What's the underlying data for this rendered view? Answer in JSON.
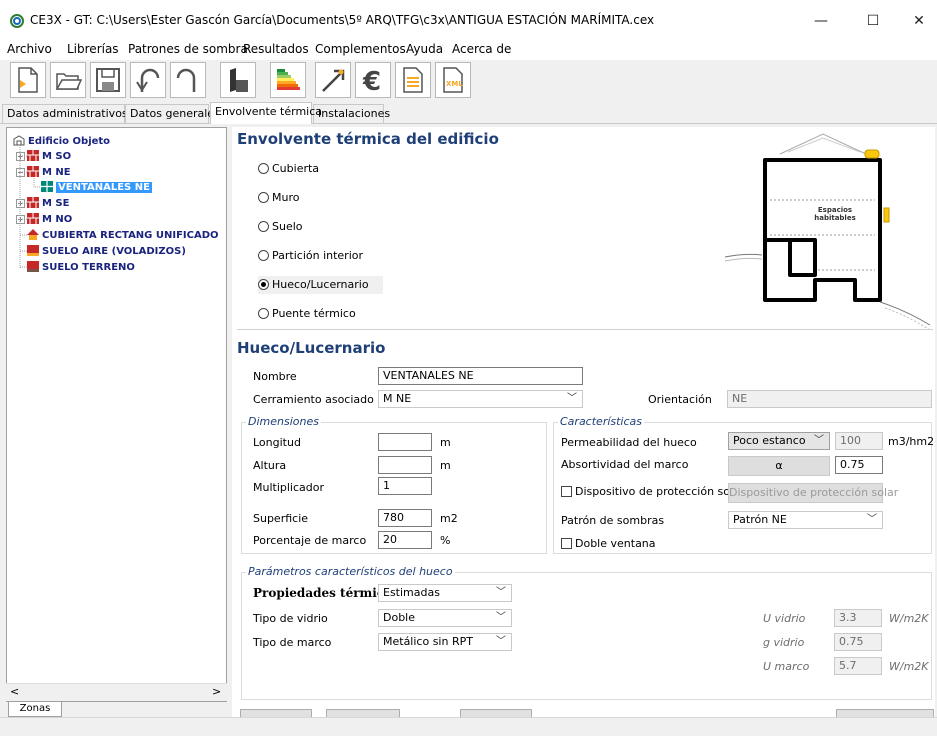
{
  "window": {
    "title": "CE3X - GT: C:\\Users\\Ester Gascón García\\Documents\\5º ARQ\\TFG\\c3x\\ANTIGUA ESTACIÓN MARÍMITA.cex",
    "minimize": "—",
    "maximize": "☐",
    "close": "✕"
  },
  "menu": [
    "Archivo",
    "Librerías",
    "Patrones de sombra",
    "Resultados",
    "Complementos",
    "Ayuda",
    "Acerca de"
  ],
  "toolbar": {
    "buttons": [
      "new-file-icon",
      "open-folder-icon",
      "save-icon",
      "undo-icon",
      "redo-icon",
      "building-icon",
      "energy-rating-icon",
      "improvement-arrow-icon",
      "euro-icon",
      "report-icon",
      "xml-export-icon"
    ],
    "euro_symbol": "€",
    "xml_text": "XML"
  },
  "tabs": [
    "Datos administrativos",
    "Datos generales",
    "Envolvente térmica",
    "Instalaciones"
  ],
  "tree": {
    "root": "Edificio Objeto",
    "items": [
      "M SO",
      "M NE",
      "VENTANALES NE",
      "M SE",
      "M NO",
      "CUBIERTA RECTANG UNIFICADO",
      "SUELO AIRE (VOLADIZOS)",
      "SUELO TERRENO"
    ],
    "expand": "+",
    "collapse": "−",
    "scroll_left": "<",
    "scroll_right": ">",
    "bottom_tab": "Zonas"
  },
  "envelope": {
    "title": "Envolvente térmica del edificio",
    "options": [
      "Cubierta",
      "Muro",
      "Suelo",
      "Partición interior",
      "Hueco/Lucernario",
      "Puente térmico"
    ],
    "diagram_label": "Espacios habitables"
  },
  "hueco": {
    "title": "Hueco/Lucernario",
    "name_label": "Nombre",
    "name_value": "VENTANALES NE",
    "closure_label": "Cerramiento asociado",
    "closure_value": "M NE",
    "orientation_label": "Orientación",
    "orientation_value": "NE"
  },
  "dimensions": {
    "title": "Dimensiones",
    "longitud_label": "Longitud",
    "longitud_value": "",
    "altura_label": "Altura",
    "altura_value": "",
    "multiplicador_label": "Multiplicador",
    "multiplicador_value": "1",
    "superficie_label": "Superficie",
    "superficie_value": "780",
    "porcentaje_label": "Porcentaje de marco",
    "porcentaje_value": "20",
    "unit_m": "m",
    "unit_m2": "m2",
    "unit_pct": "%"
  },
  "caracteristicas": {
    "title": "Características",
    "permeabilidad_label": "Permeabilidad del hueco",
    "permeabilidad_value": "Poco estanco",
    "permeabilidad_num": "100",
    "permeabilidad_unit": "m3/hm2",
    "absortividad_label": "Absortividad del marco",
    "alpha_button": "α",
    "absortividad_value": "0.75",
    "dispositivo_label": "Dispositivo de protección solar",
    "dispositivo_button": "Dispositivo de protección solar",
    "patron_label": "Patrón de sombras",
    "patron_value": "Patrón NE",
    "doble_label": "Doble ventana"
  },
  "parametros": {
    "title": "Parámetros característicos del hueco",
    "propiedades_label": "Propiedades térmicas",
    "propiedades_value": "Estimadas",
    "vidrio_label": "Tipo de vidrio",
    "vidrio_value": "Doble",
    "marco_label": "Tipo de marco",
    "marco_value": "Metálico sin RPT",
    "u_vidrio_label": "U vidrio",
    "u_vidrio_value": "3.3",
    "u_vidrio_unit": "W/m2K",
    "g_vidrio_label": "g vidrio",
    "g_vidrio_value": "0.75",
    "u_marco_label": "U marco",
    "u_marco_value": "5.7",
    "u_marco_unit": "W/m2K"
  },
  "colors": {
    "heading_blue": "#1f3f77",
    "tree_text": "#1a237e",
    "selection": "#3399ff",
    "wall_red": "#c62828"
  }
}
